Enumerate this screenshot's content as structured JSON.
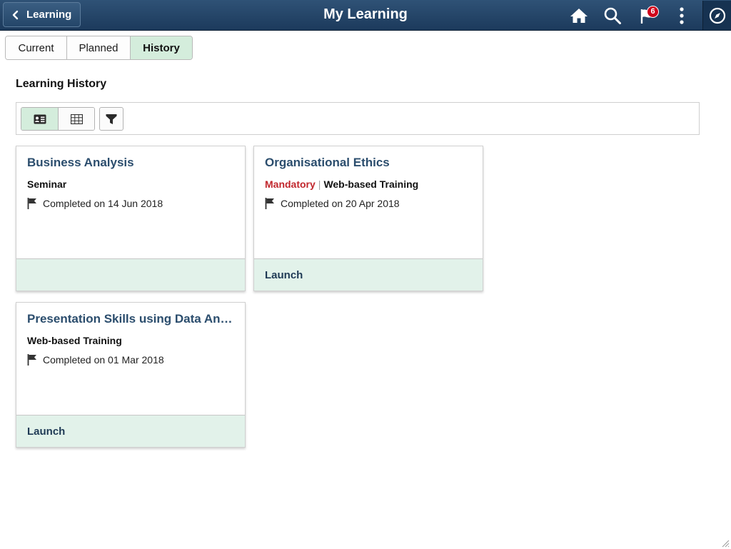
{
  "header": {
    "back_label": "Learning",
    "title": "My Learning",
    "notifications_count": "6",
    "icons": [
      "home-icon",
      "search-icon",
      "notifications-flag-icon",
      "more-actions-icon",
      "navbar-compass-icon"
    ]
  },
  "tabs": [
    {
      "label": "Current",
      "active": false
    },
    {
      "label": "Planned",
      "active": false
    },
    {
      "label": "History",
      "active": true
    }
  ],
  "section_title": "Learning History",
  "toolbar": {
    "views": [
      {
        "icon": "tile-view-icon",
        "active": true
      },
      {
        "icon": "grid-view-icon",
        "active": false
      }
    ],
    "filter_icon": "filter-icon"
  },
  "cards": [
    {
      "title": "Business Analysis",
      "mandatory": "",
      "type": "Seminar",
      "status": "Completed on 14 Jun 2018",
      "launch": ""
    },
    {
      "title": "Organisational Ethics",
      "mandatory": "Mandatory",
      "type": "Web-based Training",
      "status": "Completed on 20 Apr 2018",
      "launch": "Launch"
    },
    {
      "title": "Presentation Skills using Data An…",
      "mandatory": "",
      "type": "Web-based Training",
      "status": "Completed on 01 Mar 2018",
      "launch": "Launch"
    }
  ],
  "colors": {
    "header_bg": "#1f3f61",
    "active_tab_bg": "#d4eddc",
    "card_title": "#2b4d6d",
    "mandatory": "#c1272d",
    "card_footer": "#e2f2ea",
    "badge": "#d0021b"
  }
}
